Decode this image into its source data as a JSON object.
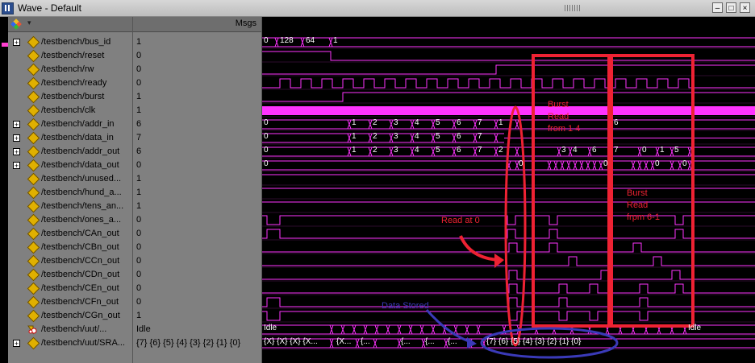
{
  "window": {
    "title": "Wave - Default",
    "controls": [
      "–",
      "□",
      "×"
    ]
  },
  "header": {
    "msgs": "Msgs"
  },
  "colors": {
    "wave": "#ff33ff",
    "grid": "#5a1a5a",
    "cursor": "#ff33ff",
    "annotation_red": "#ee2233",
    "annotation_blue": "#3a3ab8",
    "diamond": "#e0b000"
  },
  "signals": [
    {
      "name": "/testbench/bus_id",
      "value": "1",
      "expandable": true,
      "icon": "diamond-icon"
    },
    {
      "name": "/testbench/reset",
      "value": "0",
      "expandable": false,
      "icon": "diamond-icon"
    },
    {
      "name": "/testbench/rw",
      "value": "0",
      "expandable": false,
      "icon": "diamond-icon"
    },
    {
      "name": "/testbench/ready",
      "value": "0",
      "expandable": false,
      "icon": "diamond-icon"
    },
    {
      "name": "/testbench/burst",
      "value": "1",
      "expandable": false,
      "icon": "diamond-icon"
    },
    {
      "name": "/testbench/clk",
      "value": "1",
      "expandable": false,
      "icon": "diamond-icon"
    },
    {
      "name": "/testbench/addr_in",
      "value": "6",
      "expandable": true,
      "icon": "diamond-icon"
    },
    {
      "name": "/testbench/data_in",
      "value": "7",
      "expandable": true,
      "icon": "diamond-icon"
    },
    {
      "name": "/testbench/addr_out",
      "value": "6",
      "expandable": true,
      "icon": "diamond-icon"
    },
    {
      "name": "/testbench/data_out",
      "value": "0",
      "expandable": true,
      "icon": "diamond-icon"
    },
    {
      "name": "/testbench/unused...",
      "value": "1",
      "expandable": false,
      "icon": "diamond-icon"
    },
    {
      "name": "/testbench/hund_a...",
      "value": "1",
      "expandable": false,
      "icon": "diamond-icon"
    },
    {
      "name": "/testbench/tens_an...",
      "value": "1",
      "expandable": false,
      "icon": "diamond-icon"
    },
    {
      "name": "/testbench/ones_a...",
      "value": "0",
      "expandable": false,
      "icon": "diamond-icon"
    },
    {
      "name": "/testbench/CAn_out",
      "value": "0",
      "expandable": false,
      "icon": "diamond-icon"
    },
    {
      "name": "/testbench/CBn_out",
      "value": "0",
      "expandable": false,
      "icon": "diamond-icon"
    },
    {
      "name": "/testbench/CCn_out",
      "value": "0",
      "expandable": false,
      "icon": "diamond-icon"
    },
    {
      "name": "/testbench/CDn_out",
      "value": "0",
      "expandable": false,
      "icon": "diamond-icon"
    },
    {
      "name": "/testbench/CEn_out",
      "value": "0",
      "expandable": false,
      "icon": "diamond-icon"
    },
    {
      "name": "/testbench/CFn_out",
      "value": "0",
      "expandable": false,
      "icon": "diamond-icon"
    },
    {
      "name": "/testbench/CGn_out",
      "value": "1",
      "expandable": false,
      "icon": "diamond-icon"
    },
    {
      "name": "/testbench/uut/...",
      "value": "Idle",
      "expandable": false,
      "icon": "state-icon"
    },
    {
      "name": "/testbench/uut/SRA...",
      "value": "{7} {6} {5} {4} {3} {2} {1} {0}",
      "expandable": true,
      "icon": "diamond-icon"
    }
  ],
  "wave_labels": {
    "bus_id": [
      "0",
      "128",
      "64",
      "1"
    ],
    "addr_in": [
      "0",
      "1",
      "2",
      "3",
      "4",
      "5",
      "6",
      "7",
      "1",
      "6"
    ],
    "data_in": [
      "0",
      "1",
      "2",
      "3",
      "4",
      "5",
      "6",
      "7"
    ],
    "addr_out": [
      "0",
      "1",
      "2",
      "3",
      "4",
      "5",
      "6",
      "7",
      "2",
      "3",
      "4",
      "6",
      "7",
      "0",
      "1",
      "5"
    ],
    "data_out": [
      "0",
      "0",
      "0",
      "0",
      "0"
    ],
    "state": [
      "Idle",
      "Idle"
    ],
    "sram_start": "{X} {X} {X} {X...",
    "sram_mid": [
      "{X...",
      "{...",
      "{...",
      "{...",
      "{..."
    ],
    "sram_end": "{7} {6} {5} {4} {3} {2} {1} {0}"
  },
  "annotations": {
    "burst1": "Burst\nRead\nfrom 1 4",
    "burst2": "Burst\nRead\nfrpm 6-1",
    "read0": "Read at 0",
    "stored": "Data Stored"
  }
}
